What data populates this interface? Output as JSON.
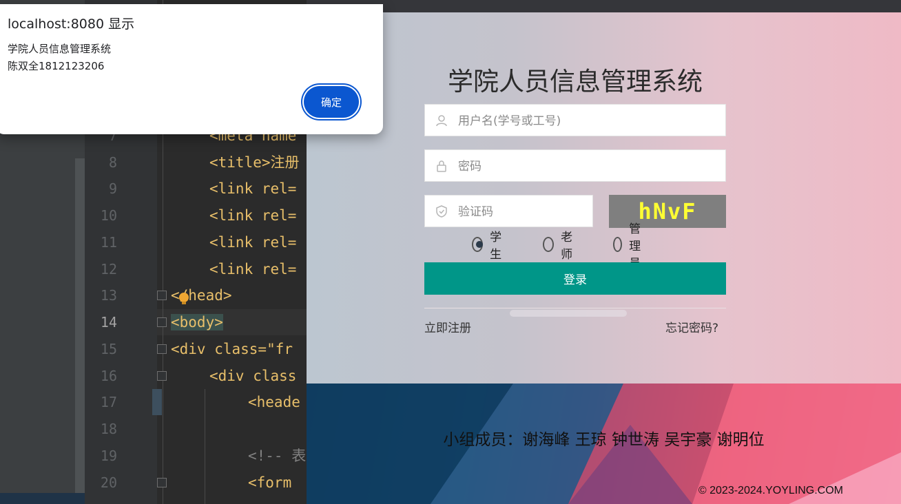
{
  "dialog": {
    "title": "localhost:8080 显示",
    "message_line1": "学院人员信息管理系统",
    "message_line2": "陈双全1812123206",
    "ok_label": "确定"
  },
  "ide": {
    "lines": [
      {
        "num": "8",
        "text": "<title>注册"
      },
      {
        "num": "9",
        "text": "<link rel="
      },
      {
        "num": "10",
        "text": "<link rel="
      },
      {
        "num": "11",
        "text": "<link rel="
      },
      {
        "num": "12",
        "text": "<link rel="
      },
      {
        "num": "13",
        "text": "</head>"
      },
      {
        "num": "14",
        "text": "<body>"
      },
      {
        "num": "15",
        "text": "<div class=\"fr"
      },
      {
        "num": "16",
        "text": "<div class"
      },
      {
        "num": "17",
        "text": "<heade"
      },
      {
        "num": "18",
        "text": ""
      },
      {
        "num": "19",
        "text": "<!-- 表"
      },
      {
        "num": "20",
        "text": "<form"
      }
    ],
    "partial_line_7": "<meta name"
  },
  "login": {
    "title": "学院人员信息管理系统",
    "username_placeholder": "用户名(学号或工号)",
    "password_placeholder": "密码",
    "captcha_placeholder": "验证码",
    "captcha_text": "hNvF",
    "roles": [
      {
        "label": "学生",
        "checked": true
      },
      {
        "label": "老师",
        "checked": false
      },
      {
        "label": "管理员",
        "checked": false
      }
    ],
    "login_button": "登录",
    "register_link": "立即注册",
    "forgot_link": "忘记密码?"
  },
  "footer": {
    "members": "小组成员：谢海峰 王琼 钟世涛 吴宇豪 谢明位",
    "copyright": "© 2023-2024.YOYLING.COM"
  },
  "colors": {
    "accent_green": "#009688",
    "dialog_button": "#0b57d0",
    "captcha_bg": "#7f7f7f",
    "captcha_fg": "#ffff33"
  }
}
